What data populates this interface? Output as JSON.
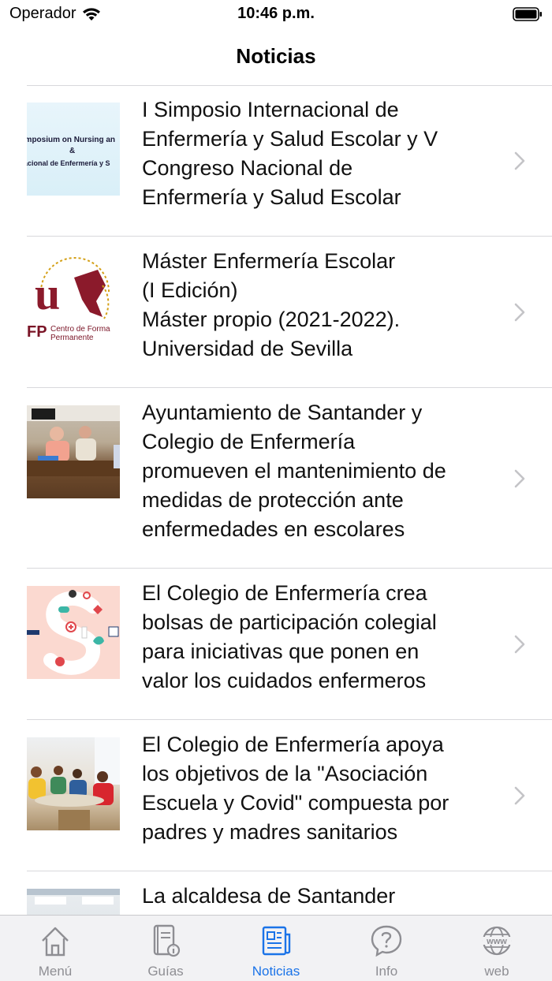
{
  "status_bar": {
    "carrier": "Operador",
    "time": "10:46 p.m."
  },
  "nav": {
    "title": "Noticias"
  },
  "news": [
    {
      "title": "I Simposio Internacional de\nEnfermería y Salud Escolar y V\nCongreso Nacional de\nEnfermería y Salud Escolar",
      "thumb_text": [
        "ymposium on Nursing an",
        "&",
        "acional de Enfermería y S"
      ]
    },
    {
      "title": "Máster Enfermería Escolar\n(I Edición)\nMáster propio (2021-2022).\nUniversidad de Sevilla",
      "thumb_text": [
        "FP",
        "Centro de Forma",
        "Permanente"
      ]
    },
    {
      "title": "Ayuntamiento de Santander y\nColegio de Enfermería\npromueven el mantenimiento de\nmedidas de protección ante\nenfermedades en escolares"
    },
    {
      "title": "El Colegio de Enfermería crea\nbolsas de participación colegial\npara iniciativas que ponen en\nvalor los cuidados enfermeros"
    },
    {
      "title": "El Colegio de Enfermería apoya\nlos objetivos de la \"Asociación\nEscuela y Covid\" compuesta por\npadres y madres sanitarios"
    },
    {
      "title": "La alcaldesa de Santander"
    }
  ],
  "tabs": [
    {
      "label": "Menú",
      "icon": "home-icon"
    },
    {
      "label": "Guías",
      "icon": "guide-icon"
    },
    {
      "label": "Noticias",
      "icon": "newspaper-icon",
      "active": true
    },
    {
      "label": "Info",
      "icon": "help-bubble-icon"
    },
    {
      "label": "web",
      "icon": "globe-www-icon"
    }
  ],
  "colors": {
    "accent": "#1a73e8",
    "tab_inactive": "#8e8e93",
    "separator": "#d8d8dc"
  }
}
